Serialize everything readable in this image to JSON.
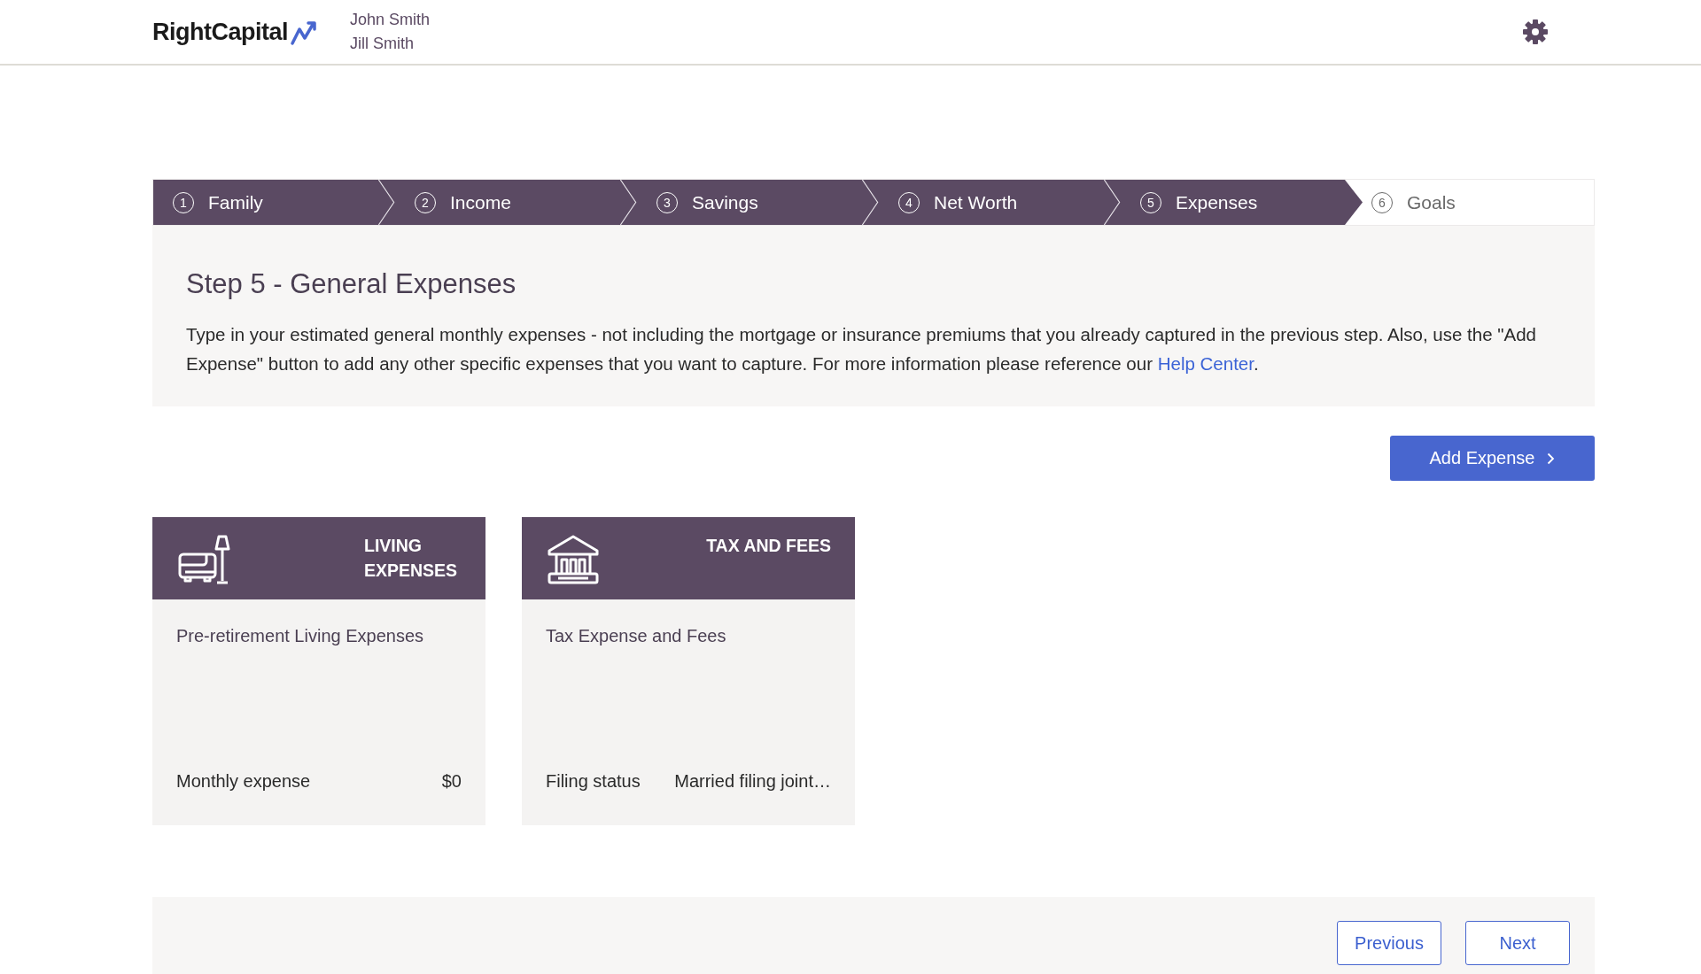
{
  "header": {
    "logo": "RightCapital",
    "clients": [
      "John Smith",
      "Jill Smith"
    ]
  },
  "steps": [
    {
      "number": "1",
      "label": "Family",
      "completed": true,
      "selected": false
    },
    {
      "number": "2",
      "label": "Income",
      "completed": true,
      "selected": false
    },
    {
      "number": "3",
      "label": "Savings",
      "completed": true,
      "selected": false
    },
    {
      "number": "4",
      "label": "Net Worth",
      "completed": true,
      "selected": false
    },
    {
      "number": "5",
      "label": "Expenses",
      "completed": false,
      "selected": true
    },
    {
      "number": "6",
      "label": "Goals",
      "completed": false,
      "selected": false
    }
  ],
  "intro": {
    "title": "Step 5 - General Expenses",
    "text": "Type in your estimated general monthly expenses - not including the mortgage or insurance premiums that you already captured in the previous step. Also, use the \"Add Expense\" button to add any other specific expenses that you want to capture. For more information please reference our",
    "link": "Help Center",
    "after_link": "."
  },
  "add_button": "Add Expense",
  "cards": [
    {
      "kind": "living",
      "title": "LIVING EXPENSES",
      "name": "Pre-retirement Living Expenses",
      "field_label": "Monthly expense",
      "field_value": "$0"
    },
    {
      "kind": "tax",
      "title": "TAX AND FEES",
      "name": "Tax Expense and Fees",
      "field_label": "Filing status",
      "field_value": "Married filing joint…"
    }
  ],
  "footer": {
    "buttons": [
      "Previous",
      "Next"
    ]
  }
}
